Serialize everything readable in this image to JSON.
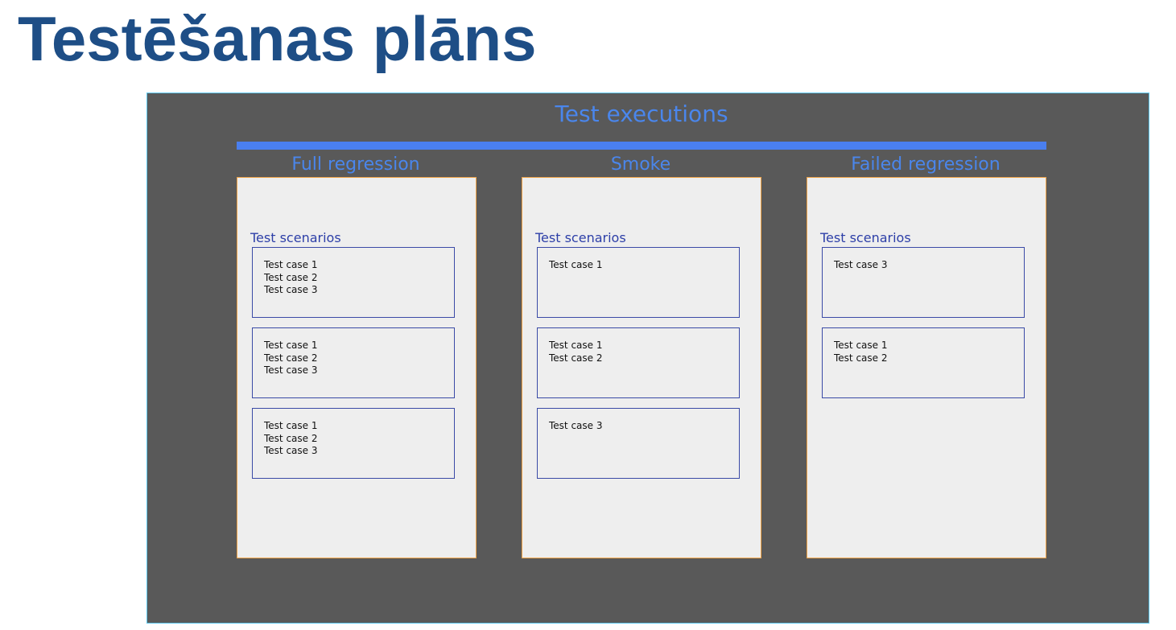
{
  "title": "Testēšanas plāns",
  "diagram": {
    "title": "Test executions",
    "columns": [
      {
        "label": "Full regression",
        "scenarios_label": "Test scenarios",
        "scenarios": [
          [
            "Test case 1",
            "Test case 2",
            "Test case 3"
          ],
          [
            "Test case 1",
            "Test case 2",
            "Test case 3"
          ],
          [
            "Test case 1",
            "Test case 2",
            "Test case 3"
          ]
        ]
      },
      {
        "label": "Smoke",
        "scenarios_label": "Test scenarios",
        "scenarios": [
          [
            "Test case 1"
          ],
          [
            "Test case 1",
            "Test case 2"
          ],
          [
            "Test case 3"
          ]
        ]
      },
      {
        "label": "Failed regression",
        "scenarios_label": "Test scenarios",
        "scenarios": [
          [
            "Test case 3"
          ],
          [
            "Test case 1",
            "Test case 2"
          ]
        ]
      }
    ]
  },
  "colors": {
    "title": "#1e4e86",
    "panel_background": "#595959",
    "panel_border": "#5ec8ee",
    "accent_blue": "#4a86ec",
    "column_border": "#f0a346",
    "column_background": "#eeeeee",
    "scenario_border": "#3a4aa6"
  }
}
